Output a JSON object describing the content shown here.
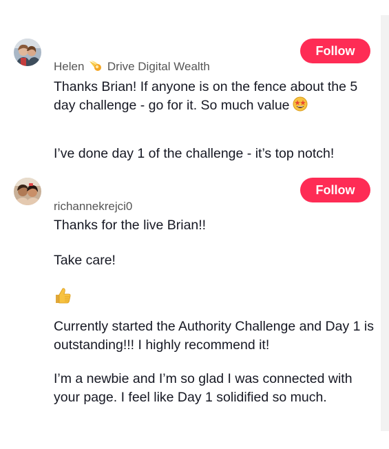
{
  "comments": [
    {
      "username": "Helen",
      "username_emoji": "comet-icon",
      "username_rest": "Drive Digital Wealth",
      "follow_label": "Follow",
      "paragraphs": [
        "Thanks Brian! If anyone is on the fence about the 5 day challenge - go for it. So much value",
        "I’ve done day 1 of the challenge - it’s top notch!"
      ],
      "inline_emoji": "star-struck-icon"
    },
    {
      "username": "richannekrejci0",
      "follow_label": "Follow",
      "paragraphs": [
        "Thanks for the live Brian!!",
        "Take care!",
        "Currently started the Authority Challenge and Day 1 is outstanding!!! I highly recommend it!",
        "I’m a newbie and I’m so glad I was connected with your page. I feel like Day 1 solidified so much."
      ],
      "standalone_emoji": "thumbs-up-icon"
    }
  ],
  "colors": {
    "follow_button": "#fe2c55",
    "username_text": "#555555",
    "body_text": "#161823"
  }
}
